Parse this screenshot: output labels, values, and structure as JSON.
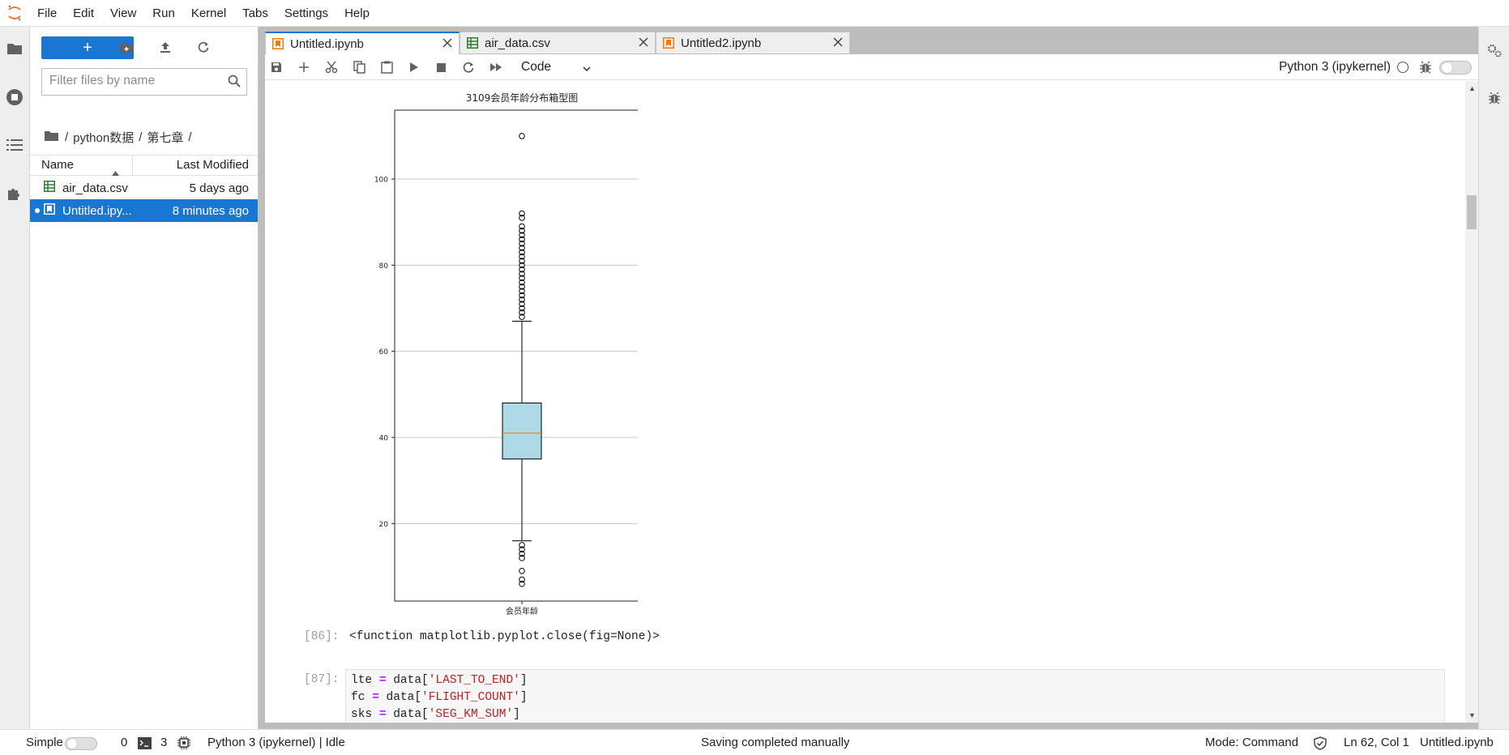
{
  "menu": [
    "File",
    "Edit",
    "View",
    "Run",
    "Kernel",
    "Tabs",
    "Settings",
    "Help"
  ],
  "filebrowser": {
    "new_label": "+",
    "filter_placeholder": "Filter files by name",
    "breadcrumb": [
      "/",
      "python数据",
      "/",
      "第七章",
      "/"
    ],
    "columns": {
      "name": "Name",
      "modified": "Last Modified"
    },
    "files": [
      {
        "name": "air_data.csv",
        "modified": "5 days ago",
        "type": "csv"
      },
      {
        "name": "Untitled.ipy...",
        "modified": "8 minutes ago",
        "type": "notebook"
      }
    ]
  },
  "tabs": [
    {
      "label": "Untitled.ipynb",
      "type": "notebook",
      "active": true
    },
    {
      "label": "air_data.csv",
      "type": "csv",
      "active": false
    },
    {
      "label": "Untitled2.ipynb",
      "type": "notebook",
      "active": false
    }
  ],
  "toolbar": {
    "cell_type": "Code",
    "kernel_name": "Python 3 (ipykernel)"
  },
  "chart_data": {
    "type": "box",
    "title": "3109会员年龄分布箱型图",
    "categories": [
      "会员年龄"
    ],
    "ylim": [
      2,
      116
    ],
    "yticks": [
      20,
      40,
      60,
      80,
      100
    ],
    "grid": "horizontal",
    "box": {
      "q1": 35,
      "median": 41,
      "q3": 48,
      "whisker_low": 16,
      "whisker_high": 67
    },
    "fill_color": "#add8e6",
    "median_color": "#ff7f0e",
    "outliers_high": [
      68,
      69,
      70,
      71,
      72,
      73,
      74,
      75,
      76,
      77,
      78,
      79,
      80,
      81,
      82,
      83,
      84,
      85,
      86,
      87,
      88,
      89,
      91,
      92,
      110
    ],
    "outliers_low": [
      6,
      7,
      9,
      12,
      13,
      14,
      15
    ]
  },
  "cells": {
    "out86_prompt": "[86]:",
    "out86_text": "<function matplotlib.pyplot.close(fig=None)>",
    "in87_prompt": "[87]:",
    "in87_lines": [
      {
        "var": "lte",
        "op": "=",
        "pre": "data[",
        "str": "'LAST_TO_END'",
        "post": "]"
      },
      {
        "var": "fc",
        "op": "=",
        "pre": "data[",
        "str": "'FLIGHT_COUNT'",
        "post": "]"
      },
      {
        "var": "sks",
        "op": "=",
        "pre": "data[",
        "str": "'SEG_KM_SUM'",
        "post": "]"
      }
    ]
  },
  "statusbar": {
    "simple_label": "Simple",
    "terminals_count": "0",
    "kernels_count": "3",
    "kernel_status": "Python 3 (ipykernel) | Idle",
    "message": "Saving completed manually",
    "mode": "Mode: Command",
    "position": "Ln 62, Col 1",
    "filename": "Untitled.ipynb"
  }
}
